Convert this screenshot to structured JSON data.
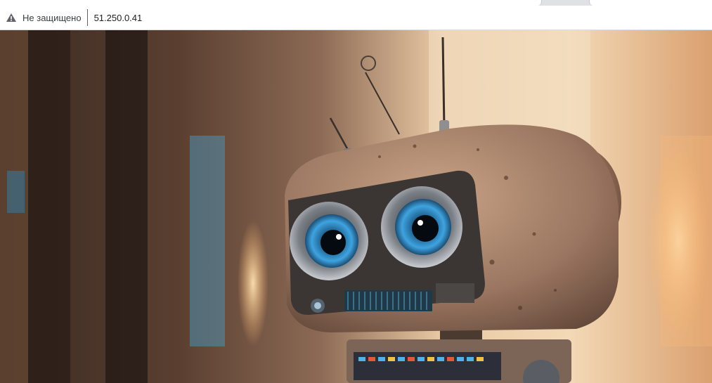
{
  "browser": {
    "address_bar": {
      "security_icon": "warning-triangle-icon",
      "security_label": "Не защищено",
      "url": "51.250.0.41"
    }
  },
  "page": {
    "image": {
      "subject_icon": "robot-illustration"
    }
  },
  "colors": {
    "robot_body": "#a8826a",
    "eye_iris": "#3fa3e0",
    "background_glow": "#f4c98e"
  }
}
